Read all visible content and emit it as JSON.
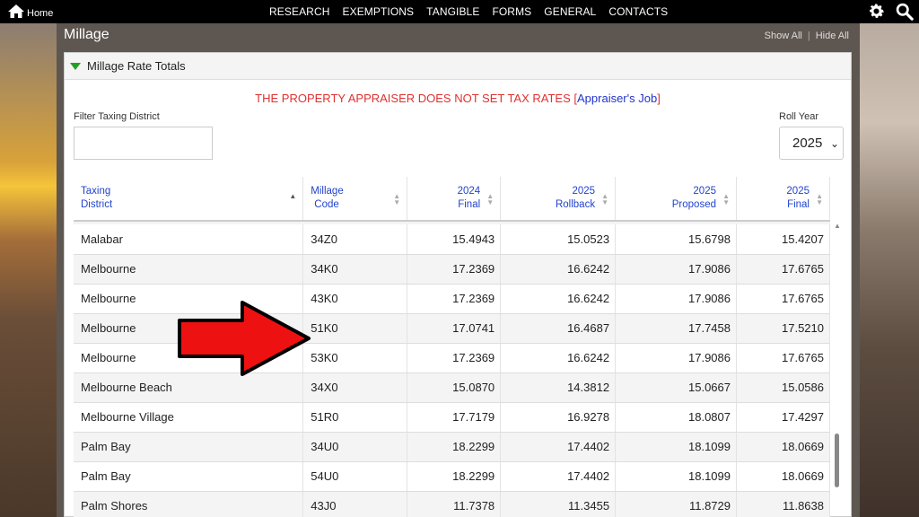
{
  "topbar": {
    "home_label": "Home",
    "nav": [
      "RESEARCH",
      "EXEMPTIONS",
      "TANGIBLE",
      "FORMS",
      "GENERAL",
      "CONTACTS"
    ],
    "icons": [
      "gear-icon",
      "search-icon"
    ]
  },
  "panel": {
    "title": "Millage",
    "show_all": "Show All",
    "hide_all": "Hide All"
  },
  "card": {
    "title": "Millage Rate Totals",
    "notice_text": "THE PROPERTY APPRAISER DOES NOT SET TAX RATES",
    "notice_link": "Appraiser's Job",
    "filter_label": "Filter Taxing District",
    "filter_value": "",
    "roll_year_label": "Roll Year",
    "roll_year_value": "2025"
  },
  "table": {
    "headers": [
      {
        "l1": "Taxing",
        "l2": "District"
      },
      {
        "l1": "Millage",
        "l2": "Code"
      },
      {
        "l1": "2024",
        "l2": "Final"
      },
      {
        "l1": "2025",
        "l2": "Rollback"
      },
      {
        "l1": "2025",
        "l2": "Proposed"
      },
      {
        "l1": "2025",
        "l2": "Final"
      }
    ],
    "rows": [
      [
        "Malabar",
        "34Z0",
        "15.4943",
        "15.0523",
        "15.6798",
        "15.4207"
      ],
      [
        "Melbourne",
        "34K0",
        "17.2369",
        "16.6242",
        "17.9086",
        "17.6765"
      ],
      [
        "Melbourne",
        "43K0",
        "17.2369",
        "16.6242",
        "17.9086",
        "17.6765"
      ],
      [
        "Melbourne",
        "51K0",
        "17.0741",
        "16.4687",
        "17.7458",
        "17.5210"
      ],
      [
        "Melbourne",
        "53K0",
        "17.2369",
        "16.6242",
        "17.9086",
        "17.6765"
      ],
      [
        "Melbourne Beach",
        "34X0",
        "15.0870",
        "14.3812",
        "15.0667",
        "15.0586"
      ],
      [
        "Melbourne Village",
        "51R0",
        "17.7179",
        "16.9278",
        "18.0807",
        "17.4297"
      ],
      [
        "Palm Bay",
        "34U0",
        "18.2299",
        "17.4402",
        "18.1099",
        "18.0669"
      ],
      [
        "Palm Bay",
        "54U0",
        "18.2299",
        "17.4402",
        "18.1099",
        "18.0669"
      ],
      [
        "Palm Shores",
        "43J0",
        "11.7378",
        "11.3455",
        "11.8729",
        "11.8638"
      ]
    ]
  },
  "colors": {
    "notice": "#e03030",
    "link": "#2233cc",
    "arrow": "#ee1111"
  }
}
